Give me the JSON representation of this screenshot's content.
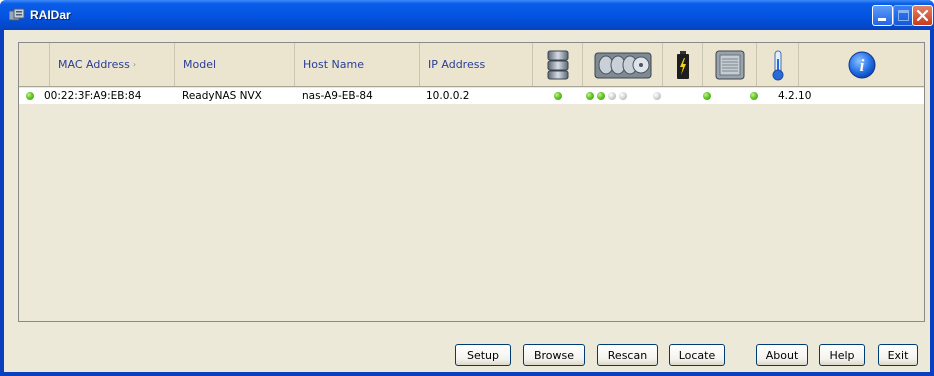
{
  "window": {
    "title": "RAIDar"
  },
  "columns": {
    "mac": "MAC Address",
    "model": "Model",
    "host": "Host Name",
    "ip": "IP Address"
  },
  "header_icons": [
    "volume-icon",
    "disks-icon",
    "battery-icon",
    "fan-icon",
    "temperature-icon",
    "info-icon"
  ],
  "devices": [
    {
      "mac": "00:22:3F:A9:EB:84",
      "model": "ReadyNAS NVX",
      "host": "nas-A9-EB-84",
      "ip": "10.0.0.2",
      "version": "4.2.10",
      "status": "green",
      "volume": "green",
      "disks": [
        "green",
        "green",
        "grey",
        "grey"
      ],
      "battery": "grey",
      "fan": "green",
      "temperature": "green"
    }
  ],
  "buttons": {
    "setup": "Setup",
    "browse": "Browse",
    "rescan": "Rescan",
    "locate": "Locate",
    "about": "About",
    "help": "Help",
    "exit": "Exit"
  },
  "colors": {
    "titlebar": "#0454e2",
    "status_green": "#62c626",
    "status_grey": "#d4d4d4",
    "header_text": "#2a3c99"
  }
}
